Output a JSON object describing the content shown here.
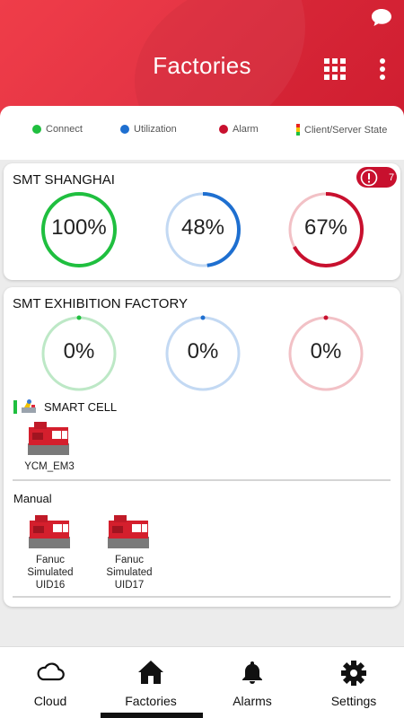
{
  "header": {
    "title": "Factories"
  },
  "legend": [
    {
      "label": "Connect",
      "color": "#1fbf3f"
    },
    {
      "label": "Utilization",
      "color": "#1e6fd0"
    },
    {
      "label": "Alarm",
      "color": "#c8102e"
    },
    {
      "label": "Client/Server State"
    }
  ],
  "factories": [
    {
      "name": "SMT SHANGHAI",
      "alarm_count": "7",
      "gauges": [
        {
          "label": "100%",
          "value": 100
        },
        {
          "label": "48%",
          "value": 48
        },
        {
          "label": "67%",
          "value": 67
        }
      ]
    },
    {
      "name": "SMT EXHIBITION FACTORY",
      "gauges": [
        {
          "label": "0%",
          "value": 0
        },
        {
          "label": "0%",
          "value": 0
        },
        {
          "label": "0%",
          "value": 0
        }
      ],
      "groups": [
        {
          "name": "SMART CELL",
          "machines": [
            {
              "lines": [
                "YCM_EM3"
              ]
            }
          ]
        },
        {
          "name": "Manual",
          "machines": [
            {
              "lines": [
                "Fanuc",
                "Simulated",
                "UID16"
              ]
            },
            {
              "lines": [
                "Fanuc",
                "Simulated",
                "UID17"
              ]
            }
          ]
        }
      ]
    }
  ],
  "nav": [
    {
      "label": "Cloud",
      "icon": "cloud-icon"
    },
    {
      "label": "Factories",
      "icon": "factory-icon",
      "active": true
    },
    {
      "label": "Alarms",
      "icon": "bell-icon"
    },
    {
      "label": "Settings",
      "icon": "gear-icon"
    }
  ]
}
